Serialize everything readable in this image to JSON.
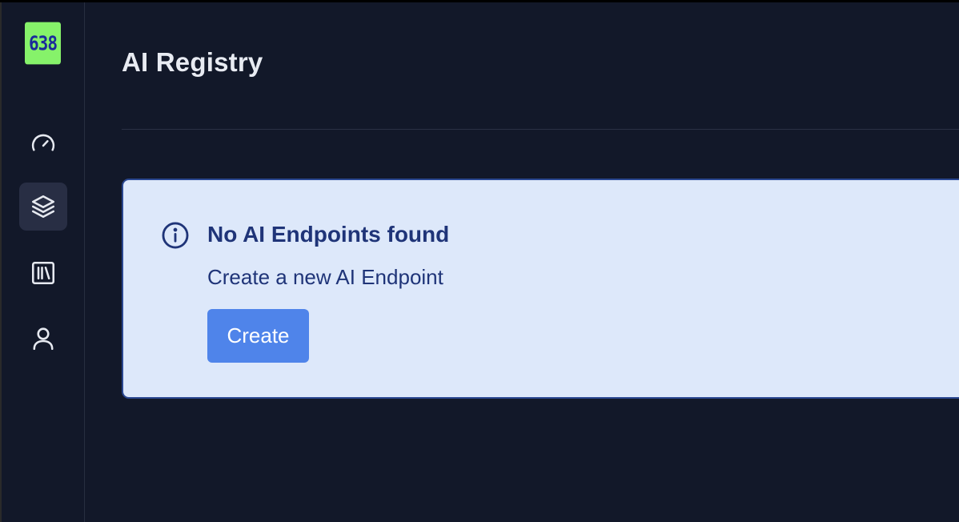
{
  "colors": {
    "background": "#121829",
    "logo_bg": "#86f26a",
    "logo_text": "#1b2a9a",
    "alert_bg": "#dde8fa",
    "alert_text": "#1f3478",
    "button_bg": "#4f84ea",
    "icon": "#e6e9f0"
  },
  "sidebar": {
    "logo_text": "638",
    "items": [
      {
        "name": "dashboard",
        "icon": "speedometer-icon",
        "active": false
      },
      {
        "name": "ai-registry",
        "icon": "layers-icon",
        "active": true
      },
      {
        "name": "library",
        "icon": "library-icon",
        "active": false
      },
      {
        "name": "account",
        "icon": "user-icon",
        "active": false
      }
    ]
  },
  "header": {
    "title": "AI Registry"
  },
  "empty_state": {
    "icon": "info-icon",
    "title": "No AI Endpoints found",
    "description": "Create a new AI Endpoint",
    "button_label": "Create"
  }
}
